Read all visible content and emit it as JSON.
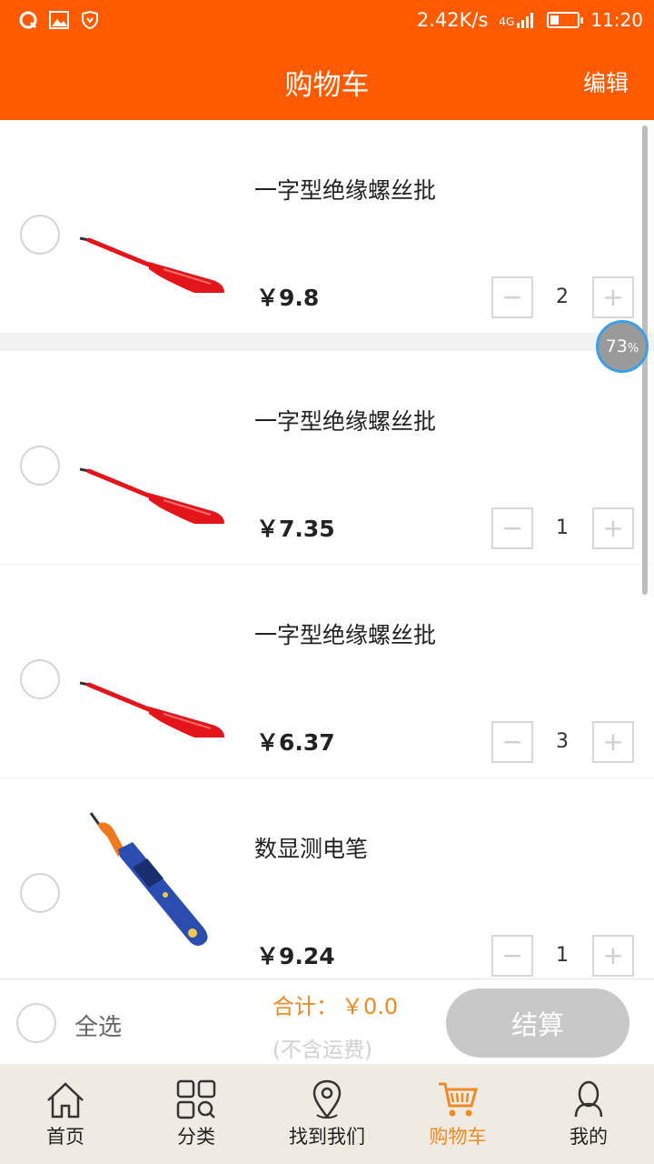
{
  "status_bar": {
    "net_speed": "2.42K/s",
    "signal_label": "4G",
    "time": "11:20"
  },
  "header": {
    "title": "购物车",
    "edit_label": "编辑"
  },
  "cart": {
    "items": [
      {
        "name": "一字型绝缘螺丝批",
        "price": "￥9.8",
        "quantity": "2",
        "image": "red-screwdriver"
      },
      {
        "name": "一字型绝缘螺丝批",
        "price": "￥7.35",
        "quantity": "1",
        "image": "red-screwdriver"
      },
      {
        "name": "一字型绝缘螺丝批",
        "price": "￥6.37",
        "quantity": "3",
        "image": "red-screwdriver"
      },
      {
        "name": "数显测电笔",
        "price": "￥9.24",
        "quantity": "1",
        "image": "digital-test-pen"
      }
    ],
    "minus_symbol": "−",
    "plus_symbol": "+"
  },
  "overlay": {
    "progress_value": "73",
    "progress_unit": "%"
  },
  "footer": {
    "select_all_label": "全选",
    "total_label": "合计：",
    "total_value": "￥0.0",
    "shipping_note": "(不含运费)",
    "checkout_label": "结算"
  },
  "tabbar": {
    "tabs": [
      {
        "label": "首页",
        "icon": "home-icon"
      },
      {
        "label": "分类",
        "icon": "category-icon"
      },
      {
        "label": "找到我们",
        "icon": "location-icon"
      },
      {
        "label": "购物车",
        "icon": "cart-icon",
        "active": true
      },
      {
        "label": "我的",
        "icon": "user-icon"
      }
    ]
  },
  "colors": {
    "brand": "#ff5a00",
    "accent": "#f08a26",
    "checkout_disabled": "#c8c8c8"
  }
}
